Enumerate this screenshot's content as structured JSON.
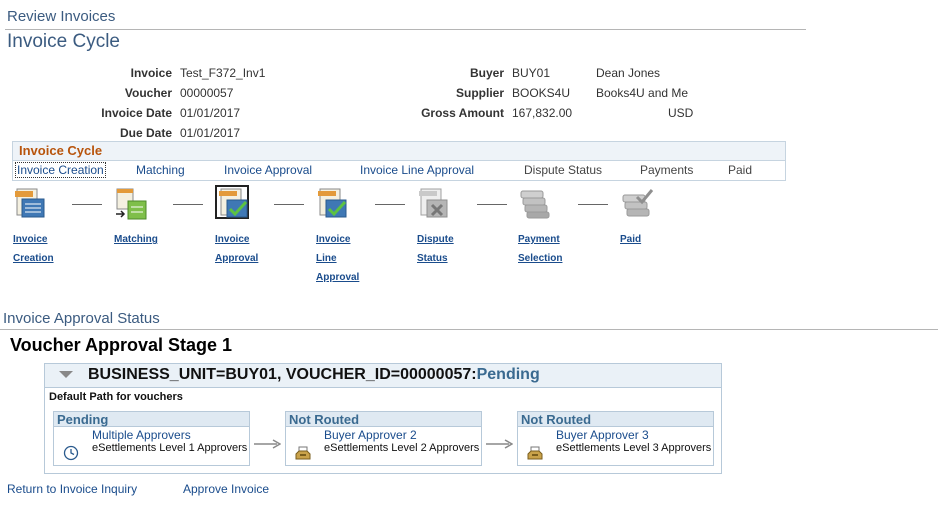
{
  "breadcrumb": "Review Invoices",
  "page_title": "Invoice Cycle",
  "fields": {
    "invoice_label": "Invoice",
    "invoice_value": "Test_F372_Inv1",
    "voucher_label": "Voucher",
    "voucher_value": "00000057",
    "invoice_date_label": "Invoice Date",
    "invoice_date_value": "01/01/2017",
    "due_date_label": "Due Date",
    "due_date_value": "01/01/2017",
    "buyer_label": "Buyer",
    "buyer_value": "BUY01",
    "buyer_name": "Dean Jones",
    "supplier_label": "Supplier",
    "supplier_value": "BOOKS4U",
    "supplier_name": "Books4U and Me",
    "gross_amount_label": "Gross Amount",
    "gross_amount_value": "167,832.00",
    "currency": "USD"
  },
  "cycle": {
    "title": "Invoice Cycle",
    "tabs": [
      {
        "label": "Invoice Creation",
        "link": true
      },
      {
        "label": "Matching",
        "link": true
      },
      {
        "label": "Invoice Approval",
        "link": true
      },
      {
        "label": "Invoice Line Approval",
        "link": true
      },
      {
        "label": "Dispute Status",
        "link": false
      },
      {
        "label": "Payments",
        "link": false
      },
      {
        "label": "Paid",
        "link": false
      }
    ],
    "steps": [
      {
        "label_line1": "Invoice",
        "label_line2": "Creation",
        "label_line3": "",
        "icon": "invoice-document-icon"
      },
      {
        "label_line1": "Matching",
        "label_line2": "",
        "label_line3": "",
        "icon": "matching-icon"
      },
      {
        "label_line1": "Invoice",
        "label_line2": "Approval",
        "label_line3": "",
        "icon": "invoice-approval-icon"
      },
      {
        "label_line1": "Invoice",
        "label_line2": "Line",
        "label_line3": "Approval",
        "icon": "line-approval-icon"
      },
      {
        "label_line1": "Dispute",
        "label_line2": "Status",
        "label_line3": "",
        "icon": "dispute-icon"
      },
      {
        "label_line1": "Payment",
        "label_line2": "Selection",
        "label_line3": "",
        "icon": "payment-icon"
      },
      {
        "label_line1": "Paid",
        "label_line2": "",
        "label_line3": "",
        "icon": "paid-icon"
      }
    ]
  },
  "approval": {
    "section_title": "Invoice Approval Status",
    "stage_title": "Voucher Approval Stage 1",
    "header_key": "BUSINESS_UNIT=BUY01, VOUCHER_ID=00000057:",
    "header_status": "Pending",
    "path_label": "Default Path for vouchers",
    "nodes": [
      {
        "status": "Pending",
        "approver": "Multiple Approvers",
        "level": "eSettlements Level 1 Approvers",
        "icon": "clock-icon"
      },
      {
        "status": "Not Routed",
        "approver": "Buyer Approver 2",
        "level": "eSettlements Level 2 Approvers",
        "icon": "inbox-icon"
      },
      {
        "status": "Not Routed",
        "approver": "Buyer Approver 3",
        "level": "eSettlements Level 3 Approvers",
        "icon": "inbox-icon"
      }
    ]
  },
  "footer": {
    "return_link": "Return to Invoice Inquiry",
    "approve_link": "Approve Invoice"
  },
  "colors": {
    "link": "#1a4c8c",
    "title": "#3b5b80",
    "cycle_title": "#b8540c",
    "status": "#3a6a90"
  }
}
